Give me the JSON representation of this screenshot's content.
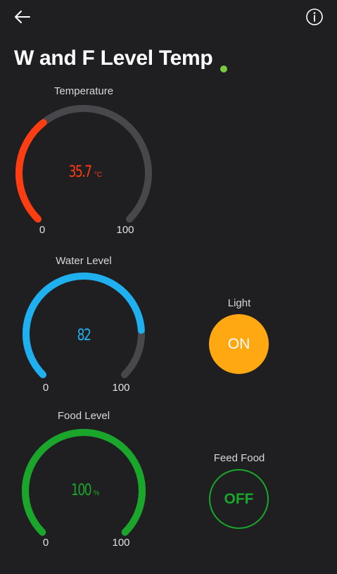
{
  "header": {
    "back_icon": "arrow-left-icon",
    "info_icon": "info-icon",
    "title": "W and F Level Temp",
    "status_color": "#7ac943"
  },
  "widgets": {
    "temperature": {
      "label": "Temperature",
      "value": 35.7,
      "value_text": "35.7",
      "unit": "°C",
      "min": "0",
      "max": "100",
      "min_value": 0,
      "max_value": 100,
      "color": "#ff3d12"
    },
    "water_level": {
      "label": "Water Level",
      "value": 82,
      "value_text": "82",
      "unit": "",
      "min": "0",
      "max": "100",
      "min_value": 0,
      "max_value": 100,
      "color": "#1fb0f0"
    },
    "food_level": {
      "label": "Food Level",
      "value": 100,
      "value_text": "100",
      "unit": "%",
      "min": "0",
      "max": "100",
      "min_value": 0,
      "max_value": 100,
      "color": "#1aa62b"
    },
    "light": {
      "label": "Light",
      "state": "ON",
      "color": "#ffa812"
    },
    "feed_food": {
      "label": "Feed Food",
      "state": "OFF",
      "color": "#1aa62b"
    }
  },
  "theme": {
    "background": "#1f1f21",
    "track": "#48484c"
  }
}
